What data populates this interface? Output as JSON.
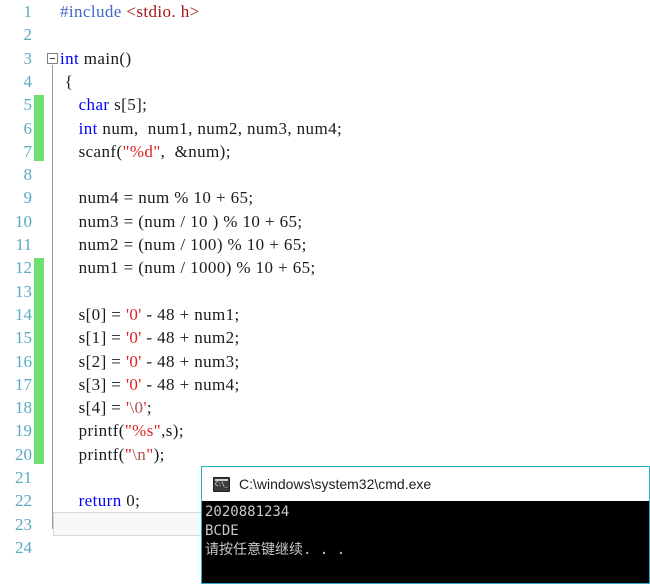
{
  "editor": {
    "first_line": 1,
    "last_line": 24,
    "current_line": 23,
    "fold_marker_line": 3,
    "change_bar_ranges": [
      [
        5,
        7
      ],
      [
        12,
        20
      ]
    ],
    "line_numbers": [
      "1",
      "2",
      "3",
      "4",
      "5",
      "6",
      "7",
      "8",
      "9",
      "10",
      "11",
      "12",
      "13",
      "14",
      "15",
      "16",
      "17",
      "18",
      "19",
      "20",
      "21",
      "22",
      "23",
      "24"
    ],
    "lines": [
      {
        "n": 1,
        "tokens": [
          {
            "t": "#include ",
            "c": "pp"
          },
          {
            "t": "<stdio. h>",
            "c": "inc"
          }
        ]
      },
      {
        "n": 2,
        "tokens": []
      },
      {
        "n": 3,
        "tokens": [
          {
            "t": "int",
            "c": "kw"
          },
          {
            "t": " main()",
            "c": "plain"
          }
        ]
      },
      {
        "n": 4,
        "tokens": [
          {
            "t": " {",
            "c": "plain"
          }
        ]
      },
      {
        "n": 5,
        "tokens": [
          {
            "t": "    ",
            "c": "plain"
          },
          {
            "t": "char",
            "c": "kw"
          },
          {
            "t": " s[5];",
            "c": "plain"
          }
        ]
      },
      {
        "n": 6,
        "tokens": [
          {
            "t": "    ",
            "c": "plain"
          },
          {
            "t": "int",
            "c": "kw"
          },
          {
            "t": " num,  num1, num2, num3, num4;",
            "c": "plain"
          }
        ]
      },
      {
        "n": 7,
        "tokens": [
          {
            "t": "    scanf(",
            "c": "plain"
          },
          {
            "t": "\"%d\"",
            "c": "str"
          },
          {
            "t": ",  &num);",
            "c": "plain"
          }
        ]
      },
      {
        "n": 8,
        "tokens": []
      },
      {
        "n": 9,
        "tokens": [
          {
            "t": "    num4 = num % 10 + 65;",
            "c": "plain"
          }
        ]
      },
      {
        "n": 10,
        "tokens": [
          {
            "t": "    num3 = (num / 10 ) % 10 + 65;",
            "c": "plain"
          }
        ]
      },
      {
        "n": 11,
        "tokens": [
          {
            "t": "    num2 = (num / 100) % 10 + 65;",
            "c": "plain"
          }
        ]
      },
      {
        "n": 12,
        "tokens": [
          {
            "t": "    num1 = (num / 1000) % 10 + 65;",
            "c": "plain"
          }
        ]
      },
      {
        "n": 13,
        "tokens": []
      },
      {
        "n": 14,
        "tokens": [
          {
            "t": "    s[0] = ",
            "c": "plain"
          },
          {
            "t": "'0'",
            "c": "str"
          },
          {
            "t": " - 48 + num1;",
            "c": "plain"
          }
        ]
      },
      {
        "n": 15,
        "tokens": [
          {
            "t": "    s[1] = ",
            "c": "plain"
          },
          {
            "t": "'0'",
            "c": "str"
          },
          {
            "t": " - 48 + num2;",
            "c": "plain"
          }
        ]
      },
      {
        "n": 16,
        "tokens": [
          {
            "t": "    s[2] = ",
            "c": "plain"
          },
          {
            "t": "'0'",
            "c": "str"
          },
          {
            "t": " - 48 + num3;",
            "c": "plain"
          }
        ]
      },
      {
        "n": 17,
        "tokens": [
          {
            "t": "    s[3] = ",
            "c": "plain"
          },
          {
            "t": "'0'",
            "c": "str"
          },
          {
            "t": " - 48 + num4;",
            "c": "plain"
          }
        ]
      },
      {
        "n": 18,
        "tokens": [
          {
            "t": "    s[4] = ",
            "c": "plain"
          },
          {
            "t": "'",
            "c": "str"
          },
          {
            "t": "\\0",
            "c": "esc"
          },
          {
            "t": "'",
            "c": "str"
          },
          {
            "t": ";",
            "c": "plain"
          }
        ]
      },
      {
        "n": 19,
        "tokens": [
          {
            "t": "    printf(",
            "c": "plain"
          },
          {
            "t": "\"%s\"",
            "c": "str"
          },
          {
            "t": ",s);",
            "c": "plain"
          }
        ]
      },
      {
        "n": 20,
        "tokens": [
          {
            "t": "    printf(",
            "c": "plain"
          },
          {
            "t": "\"",
            "c": "str"
          },
          {
            "t": "\\n",
            "c": "esc"
          },
          {
            "t": "\"",
            "c": "str"
          },
          {
            "t": ");",
            "c": "plain"
          }
        ]
      },
      {
        "n": 21,
        "tokens": []
      },
      {
        "n": 22,
        "tokens": [
          {
            "t": "    ",
            "c": "plain"
          },
          {
            "t": "return",
            "c": "kw"
          },
          {
            "t": " 0;",
            "c": "plain"
          }
        ]
      },
      {
        "n": 23,
        "tokens": [
          {
            "t": "}",
            "c": "plain"
          }
        ]
      },
      {
        "n": 24,
        "tokens": []
      }
    ]
  },
  "console": {
    "icon": "cmd-icon",
    "title": "C:\\windows\\system32\\cmd.exe",
    "output_lines": [
      "2020881234",
      "BCDE",
      "请按任意键继续. . ."
    ]
  },
  "colors": {
    "line_number": "#2b91af",
    "keyword": "#0000ff",
    "preprocessor": "#4169c8",
    "include_path": "#a31515",
    "string": "#dd2222",
    "escape": "#b05050",
    "change_bar": "#6fdf6f",
    "console_border": "#2aaeca",
    "console_background": "#000000",
    "console_text": "#c8c8c8",
    "current_line_background": "#f7f7f7"
  }
}
